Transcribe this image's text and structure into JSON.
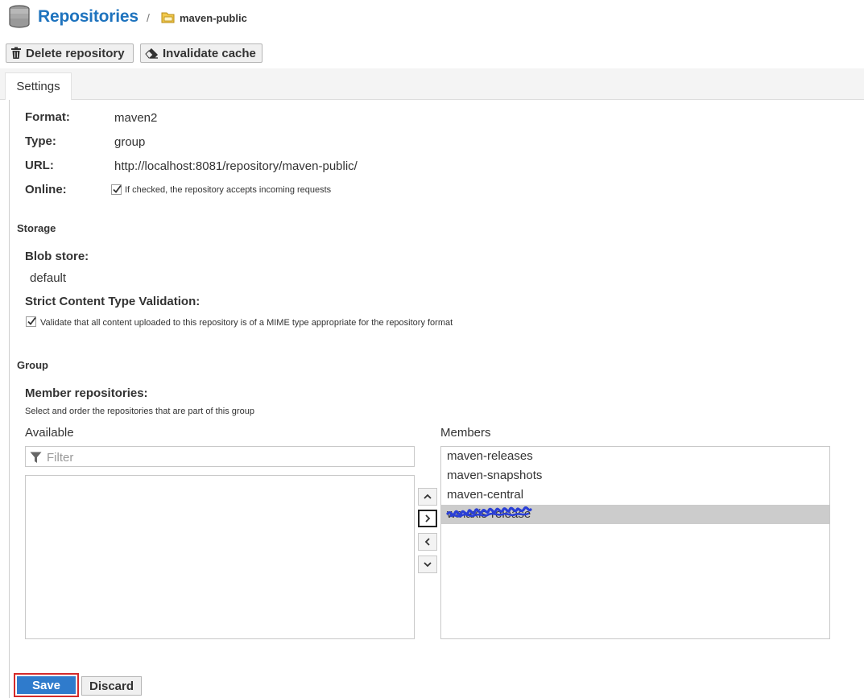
{
  "header": {
    "title": "Repositories",
    "separator": "/",
    "breadcrumb": "maven-public"
  },
  "toolbar": {
    "delete_label": "Delete repository",
    "invalidate_label": "Invalidate cache"
  },
  "tabs": [
    {
      "label": "Settings"
    }
  ],
  "settings": {
    "format_label": "Format:",
    "format_value": "maven2",
    "type_label": "Type:",
    "type_value": "group",
    "url_label": "URL:",
    "url_value": "http://localhost:8081/repository/maven-public/",
    "online_label": "Online:",
    "online_checked": true,
    "online_help": "If checked, the repository accepts incoming requests"
  },
  "storage": {
    "section_title": "Storage",
    "blob_label": "Blob store:",
    "blob_value": "default",
    "strict_label": "Strict Content Type Validation:",
    "strict_checked": true,
    "strict_help": "Validate that all content uploaded to this repository is of a MIME type appropriate for the repository format"
  },
  "group": {
    "section_title": "Group",
    "members_label": "Member repositories:",
    "members_help": "Select and order the repositories that are part of this group",
    "available_title": "Available",
    "members_title": "Members",
    "filter_placeholder": "Filter",
    "members": [
      "maven-releases",
      "maven-snapshots",
      "maven-central",
      "wmaxis-release"
    ],
    "selected_member_index": 3
  },
  "actions": {
    "save_label": "Save",
    "discard_label": "Discard"
  },
  "colors": {
    "accent": "#1e73be",
    "save_button": "#2f7bcc",
    "save_highlight": "#d42a2a",
    "selected_row": "#cccccc",
    "scribble": "#2a3fd6"
  },
  "icons": {
    "title": "database-icon",
    "breadcrumb": "folder-icon",
    "delete": "trash-icon",
    "invalidate": "eraser-icon",
    "filter": "filter-icon",
    "move_up": "chevron-up-icon",
    "add": "chevron-right-icon",
    "remove": "chevron-left-icon",
    "move_down": "chevron-down-icon"
  }
}
